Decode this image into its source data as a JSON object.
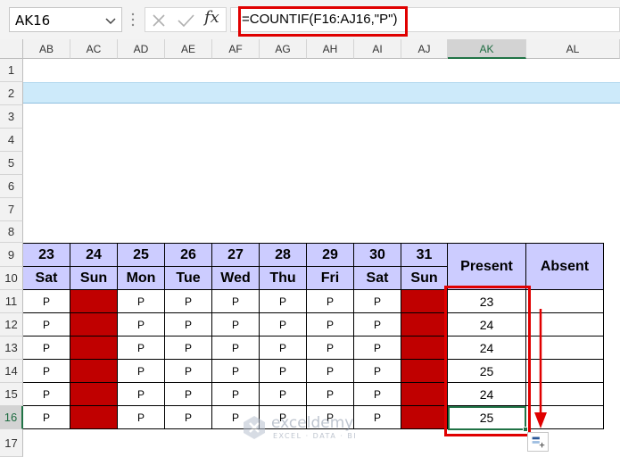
{
  "formula_bar": {
    "name_box": "AK16",
    "formula": "=COUNTIF(F16:AJ16,\"P\")",
    "fx_label": "fx"
  },
  "columns": [
    "AB",
    "AC",
    "AD",
    "AE",
    "AF",
    "AG",
    "AH",
    "AI",
    "AJ",
    "AK",
    "AL"
  ],
  "rows": [
    "1",
    "2",
    "3",
    "4",
    "5",
    "6",
    "7",
    "8",
    "9",
    "10",
    "11",
    "12",
    "13",
    "14",
    "15",
    "16",
    "17"
  ],
  "table": {
    "days": [
      "23",
      "24",
      "25",
      "26",
      "27",
      "28",
      "29",
      "30",
      "31"
    ],
    "weekdays": [
      "Sat",
      "Sun",
      "Mon",
      "Tue",
      "Wed",
      "Thu",
      "Fri",
      "Sat",
      "Sun"
    ],
    "present_header": "Present",
    "absent_header": "Absent",
    "attendance_mark": "P",
    "present_counts": [
      "23",
      "24",
      "24",
      "25",
      "24",
      "25"
    ]
  },
  "watermark": {
    "name": "exceldemy",
    "tagline": "EXCEL · DATA · BI"
  },
  "colors": {
    "header_fill": "#ccccff",
    "weekend_fill": "#c00000",
    "highlight_red": "#e00000",
    "selection_green": "#217346",
    "banner_fill": "#cdeafa"
  }
}
